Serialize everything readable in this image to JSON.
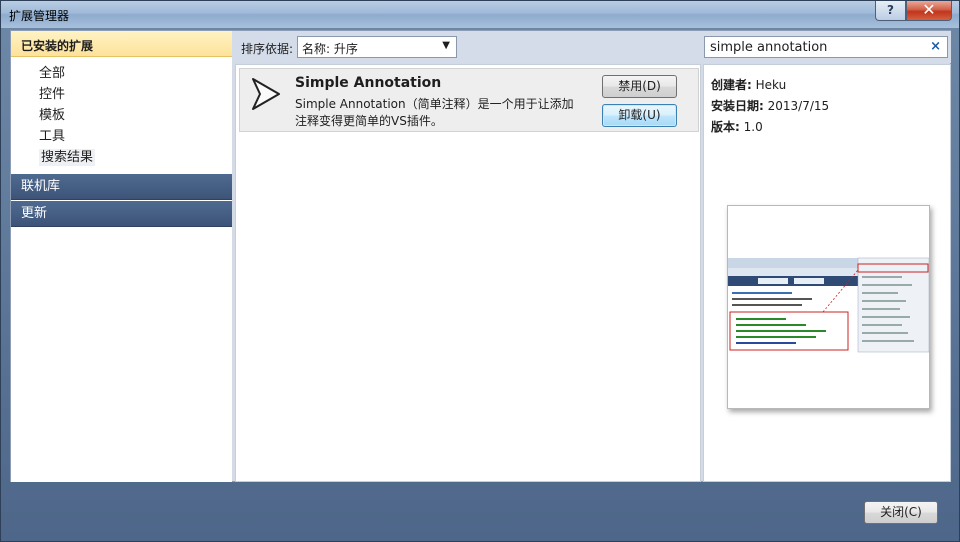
{
  "window": {
    "title": "扩展管理器",
    "help_glyph": "?",
    "close_glyph": "✕"
  },
  "sidebar": {
    "header": "已安装的扩展",
    "items": [
      {
        "label": "全部"
      },
      {
        "label": "控件"
      },
      {
        "label": "模板"
      },
      {
        "label": "工具"
      },
      {
        "label": "搜索结果"
      }
    ],
    "sections": [
      {
        "label": "联机库"
      },
      {
        "label": "更新"
      }
    ]
  },
  "toolbar": {
    "sort_label": "排序依据:",
    "sort_value": "名称: 升序",
    "search_value": "simple annotation",
    "search_clear_glyph": "×"
  },
  "extension": {
    "name": "Simple Annotation",
    "description": "Simple Annotation（简单注释）是一个用于让添加注释变得更简单的VS插件。",
    "disable_label": "禁用(D)",
    "uninstall_label": "卸载(U)"
  },
  "details": {
    "author_label": "创建者:",
    "author_value": "Heku",
    "install_date_label": "安装日期:",
    "install_date_value": "2013/7/15",
    "version_label": "版本:",
    "version_value": "1.0"
  },
  "footer": {
    "close_label": "关闭(C)"
  },
  "icons": {
    "extension_icon": "play-triangle-icon",
    "sort_dropdown": "chevron-down-icon",
    "search_clear": "clear-icon"
  }
}
